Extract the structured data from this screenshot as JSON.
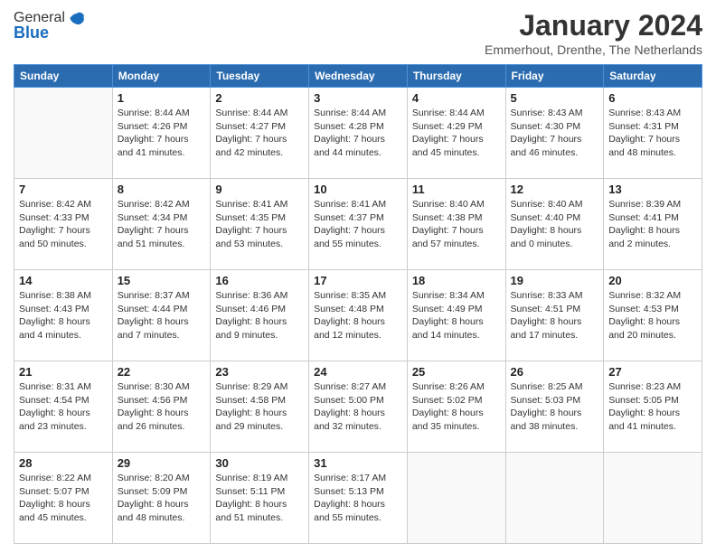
{
  "logo": {
    "general": "General",
    "blue": "Blue"
  },
  "header": {
    "title": "January 2024",
    "location": "Emmerhout, Drenthe, The Netherlands"
  },
  "weekdays": [
    "Sunday",
    "Monday",
    "Tuesday",
    "Wednesday",
    "Thursday",
    "Friday",
    "Saturday"
  ],
  "weeks": [
    [
      {
        "day": "",
        "sunrise": "",
        "sunset": "",
        "daylight": ""
      },
      {
        "day": "1",
        "sunrise": "Sunrise: 8:44 AM",
        "sunset": "Sunset: 4:26 PM",
        "daylight": "Daylight: 7 hours and 41 minutes."
      },
      {
        "day": "2",
        "sunrise": "Sunrise: 8:44 AM",
        "sunset": "Sunset: 4:27 PM",
        "daylight": "Daylight: 7 hours and 42 minutes."
      },
      {
        "day": "3",
        "sunrise": "Sunrise: 8:44 AM",
        "sunset": "Sunset: 4:28 PM",
        "daylight": "Daylight: 7 hours and 44 minutes."
      },
      {
        "day": "4",
        "sunrise": "Sunrise: 8:44 AM",
        "sunset": "Sunset: 4:29 PM",
        "daylight": "Daylight: 7 hours and 45 minutes."
      },
      {
        "day": "5",
        "sunrise": "Sunrise: 8:43 AM",
        "sunset": "Sunset: 4:30 PM",
        "daylight": "Daylight: 7 hours and 46 minutes."
      },
      {
        "day": "6",
        "sunrise": "Sunrise: 8:43 AM",
        "sunset": "Sunset: 4:31 PM",
        "daylight": "Daylight: 7 hours and 48 minutes."
      }
    ],
    [
      {
        "day": "7",
        "sunrise": "Sunrise: 8:42 AM",
        "sunset": "Sunset: 4:33 PM",
        "daylight": "Daylight: 7 hours and 50 minutes."
      },
      {
        "day": "8",
        "sunrise": "Sunrise: 8:42 AM",
        "sunset": "Sunset: 4:34 PM",
        "daylight": "Daylight: 7 hours and 51 minutes."
      },
      {
        "day": "9",
        "sunrise": "Sunrise: 8:41 AM",
        "sunset": "Sunset: 4:35 PM",
        "daylight": "Daylight: 7 hours and 53 minutes."
      },
      {
        "day": "10",
        "sunrise": "Sunrise: 8:41 AM",
        "sunset": "Sunset: 4:37 PM",
        "daylight": "Daylight: 7 hours and 55 minutes."
      },
      {
        "day": "11",
        "sunrise": "Sunrise: 8:40 AM",
        "sunset": "Sunset: 4:38 PM",
        "daylight": "Daylight: 7 hours and 57 minutes."
      },
      {
        "day": "12",
        "sunrise": "Sunrise: 8:40 AM",
        "sunset": "Sunset: 4:40 PM",
        "daylight": "Daylight: 8 hours and 0 minutes."
      },
      {
        "day": "13",
        "sunrise": "Sunrise: 8:39 AM",
        "sunset": "Sunset: 4:41 PM",
        "daylight": "Daylight: 8 hours and 2 minutes."
      }
    ],
    [
      {
        "day": "14",
        "sunrise": "Sunrise: 8:38 AM",
        "sunset": "Sunset: 4:43 PM",
        "daylight": "Daylight: 8 hours and 4 minutes."
      },
      {
        "day": "15",
        "sunrise": "Sunrise: 8:37 AM",
        "sunset": "Sunset: 4:44 PM",
        "daylight": "Daylight: 8 hours and 7 minutes."
      },
      {
        "day": "16",
        "sunrise": "Sunrise: 8:36 AM",
        "sunset": "Sunset: 4:46 PM",
        "daylight": "Daylight: 8 hours and 9 minutes."
      },
      {
        "day": "17",
        "sunrise": "Sunrise: 8:35 AM",
        "sunset": "Sunset: 4:48 PM",
        "daylight": "Daylight: 8 hours and 12 minutes."
      },
      {
        "day": "18",
        "sunrise": "Sunrise: 8:34 AM",
        "sunset": "Sunset: 4:49 PM",
        "daylight": "Daylight: 8 hours and 14 minutes."
      },
      {
        "day": "19",
        "sunrise": "Sunrise: 8:33 AM",
        "sunset": "Sunset: 4:51 PM",
        "daylight": "Daylight: 8 hours and 17 minutes."
      },
      {
        "day": "20",
        "sunrise": "Sunrise: 8:32 AM",
        "sunset": "Sunset: 4:53 PM",
        "daylight": "Daylight: 8 hours and 20 minutes."
      }
    ],
    [
      {
        "day": "21",
        "sunrise": "Sunrise: 8:31 AM",
        "sunset": "Sunset: 4:54 PM",
        "daylight": "Daylight: 8 hours and 23 minutes."
      },
      {
        "day": "22",
        "sunrise": "Sunrise: 8:30 AM",
        "sunset": "Sunset: 4:56 PM",
        "daylight": "Daylight: 8 hours and 26 minutes."
      },
      {
        "day": "23",
        "sunrise": "Sunrise: 8:29 AM",
        "sunset": "Sunset: 4:58 PM",
        "daylight": "Daylight: 8 hours and 29 minutes."
      },
      {
        "day": "24",
        "sunrise": "Sunrise: 8:27 AM",
        "sunset": "Sunset: 5:00 PM",
        "daylight": "Daylight: 8 hours and 32 minutes."
      },
      {
        "day": "25",
        "sunrise": "Sunrise: 8:26 AM",
        "sunset": "Sunset: 5:02 PM",
        "daylight": "Daylight: 8 hours and 35 minutes."
      },
      {
        "day": "26",
        "sunrise": "Sunrise: 8:25 AM",
        "sunset": "Sunset: 5:03 PM",
        "daylight": "Daylight: 8 hours and 38 minutes."
      },
      {
        "day": "27",
        "sunrise": "Sunrise: 8:23 AM",
        "sunset": "Sunset: 5:05 PM",
        "daylight": "Daylight: 8 hours and 41 minutes."
      }
    ],
    [
      {
        "day": "28",
        "sunrise": "Sunrise: 8:22 AM",
        "sunset": "Sunset: 5:07 PM",
        "daylight": "Daylight: 8 hours and 45 minutes."
      },
      {
        "day": "29",
        "sunrise": "Sunrise: 8:20 AM",
        "sunset": "Sunset: 5:09 PM",
        "daylight": "Daylight: 8 hours and 48 minutes."
      },
      {
        "day": "30",
        "sunrise": "Sunrise: 8:19 AM",
        "sunset": "Sunset: 5:11 PM",
        "daylight": "Daylight: 8 hours and 51 minutes."
      },
      {
        "day": "31",
        "sunrise": "Sunrise: 8:17 AM",
        "sunset": "Sunset: 5:13 PM",
        "daylight": "Daylight: 8 hours and 55 minutes."
      },
      {
        "day": "",
        "sunrise": "",
        "sunset": "",
        "daylight": ""
      },
      {
        "day": "",
        "sunrise": "",
        "sunset": "",
        "daylight": ""
      },
      {
        "day": "",
        "sunrise": "",
        "sunset": "",
        "daylight": ""
      }
    ]
  ]
}
